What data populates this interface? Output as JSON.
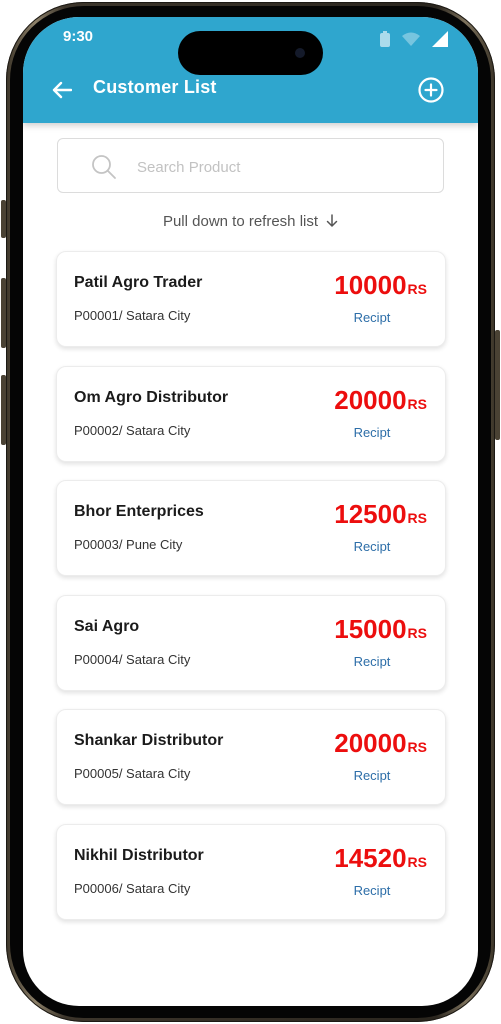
{
  "status_bar": {
    "time": "9:30"
  },
  "header": {
    "title": "Customer List",
    "back_icon": "arrow-left-icon",
    "add_icon": "plus-circle-icon",
    "color": "#2fa6ce"
  },
  "search": {
    "placeholder": "Search Product",
    "value": "",
    "icon": "search-icon"
  },
  "refresh_hint": "Pull down to refresh list",
  "customers": [
    {
      "name": "Patil Agro Trader",
      "code_city": "P00001/ Satara City",
      "amount": "10000",
      "currency": "RS",
      "action": "Recipt"
    },
    {
      "name": "Om Agro Distributor",
      "code_city": "P00002/ Satara City",
      "amount": "20000",
      "currency": "RS",
      "action": "Recipt"
    },
    {
      "name": "Bhor Enterprices",
      "code_city": "P00003/ Pune City",
      "amount": "12500",
      "currency": "RS",
      "action": "Recipt"
    },
    {
      "name": "Sai Agro",
      "code_city": "P00004/ Satara City",
      "amount": "15000",
      "currency": "RS",
      "action": "Recipt"
    },
    {
      "name": "Shankar Distributor",
      "code_city": "P00005/ Satara City",
      "amount": "20000",
      "currency": "RS",
      "action": "Recipt"
    },
    {
      "name": "Nikhil Distributor",
      "code_city": "P00006/ Satara City",
      "amount": "14520",
      "currency": "RS",
      "action": "Recipt"
    }
  ],
  "colors": {
    "amount": "#ec0e0e",
    "link": "#2d6ea8"
  }
}
